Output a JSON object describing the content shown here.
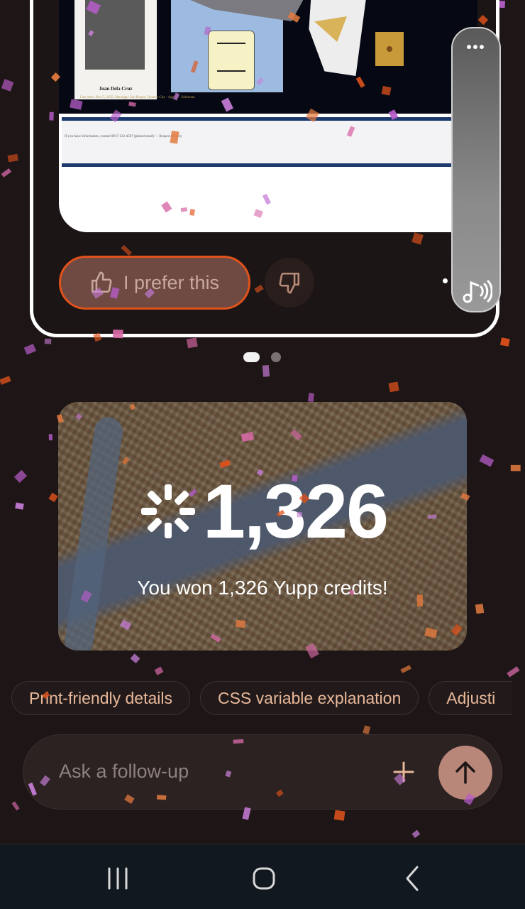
{
  "preview": {
    "profile_name": "Juan Dela Cruz",
    "lost_line": "Last seen: Nov 5, 2025 | Barangay San Roque, Quezon City · Age 45 · Salesman",
    "info_text": "If you have information, contact 0917-123-4567 (phone/email) — Respect privacy"
  },
  "actions": {
    "prefer_label": "I prefer this"
  },
  "reward": {
    "amount": "1,326",
    "message": "You won 1,326 Yupp credits!"
  },
  "suggestions": [
    "Print-friendly details",
    "CSS variable explanation",
    "Adjusti"
  ],
  "input": {
    "placeholder": "Ask a follow-up"
  },
  "colors": {
    "background": "#1e1616",
    "accent_orange": "#e0521c",
    "send_button": "#b9877a",
    "chip_text": "#e8b89a"
  },
  "icons": [
    "thumbs-up-icon",
    "thumbs-down-icon",
    "more-dots-icon",
    "audio-icon",
    "spark-icon",
    "plus-icon",
    "arrow-up-icon",
    "recents-icon",
    "home-icon",
    "back-icon"
  ]
}
